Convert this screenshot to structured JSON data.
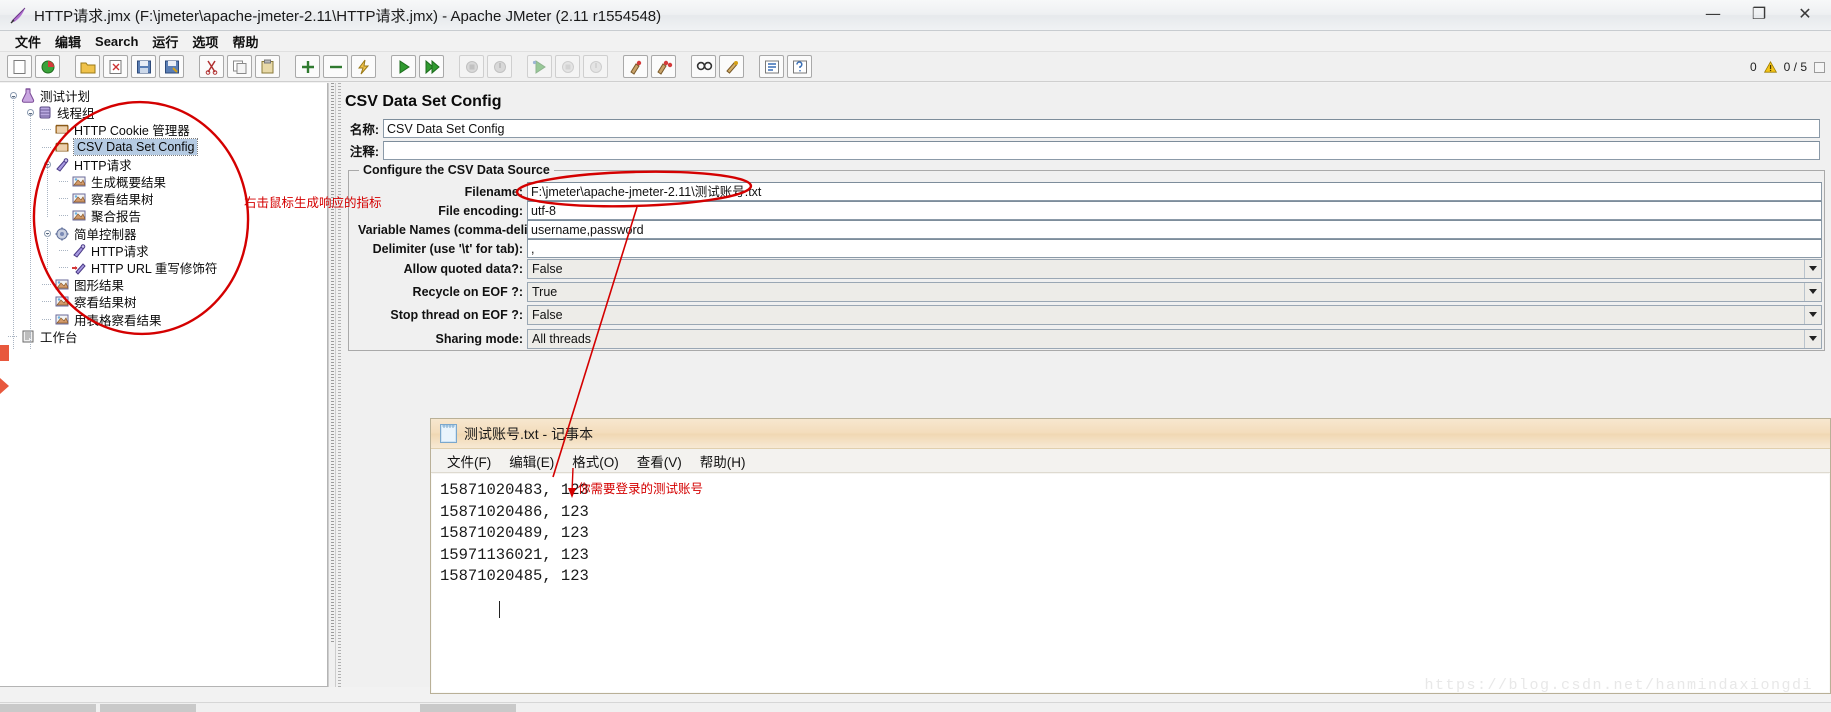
{
  "window": {
    "title": "HTTP请求.jmx (F:\\jmeter\\apache-jmeter-2.11\\HTTP请求.jmx) - Apache JMeter (2.11 r1554548)",
    "icon": "jmeter-feather-icon",
    "minimize_label": "—",
    "maximize_label": "❐",
    "close_label": "✕"
  },
  "menubar": {
    "items": [
      {
        "label": "文件",
        "name": "menu-file"
      },
      {
        "label": "编辑",
        "name": "menu-edit"
      },
      {
        "label": "Search",
        "name": "menu-search"
      },
      {
        "label": "运行",
        "name": "menu-run"
      },
      {
        "label": "选项",
        "name": "menu-options"
      },
      {
        "label": "帮助",
        "name": "menu-help"
      }
    ]
  },
  "toolbar": {
    "buttons": [
      {
        "name": "new-icon",
        "tip": "新建"
      },
      {
        "name": "templates-icon",
        "tip": "模板"
      },
      {
        "name": "open-icon",
        "tip": "打开"
      },
      {
        "name": "close-icon",
        "tip": "关闭"
      },
      {
        "name": "save-icon",
        "tip": "保存"
      },
      {
        "name": "save-as-icon",
        "tip": "另存为"
      },
      {
        "name": "cut-icon",
        "tip": "剪切"
      },
      {
        "name": "copy-icon",
        "tip": "复制"
      },
      {
        "name": "paste-icon",
        "tip": "粘贴"
      },
      {
        "name": "expand-icon",
        "tip": "展开全部"
      },
      {
        "name": "collapse-icon",
        "tip": "收起全部"
      },
      {
        "name": "toggle-icon",
        "tip": "启用/禁用"
      },
      {
        "name": "start-icon",
        "tip": "启动"
      },
      {
        "name": "start-no-pause-icon",
        "tip": "无间断启动"
      },
      {
        "name": "stop-icon",
        "tip": "停止"
      },
      {
        "name": "shutdown-icon",
        "tip": "关闭"
      },
      {
        "name": "remote-start-icon",
        "tip": "远程启动"
      },
      {
        "name": "remote-stop-icon",
        "tip": "远程停止"
      },
      {
        "name": "remote-shutdown-icon",
        "tip": "远程关闭"
      },
      {
        "name": "clear-icon",
        "tip": "清除"
      },
      {
        "name": "clear-all-icon",
        "tip": "清除全部"
      },
      {
        "name": "search-icon",
        "tip": "查找"
      },
      {
        "name": "search-reset-icon",
        "tip": "重置查找"
      },
      {
        "name": "function-helper-icon",
        "tip": "函数助手对话框"
      },
      {
        "name": "help-icon",
        "tip": "帮助"
      }
    ],
    "status": {
      "warning_count": "0",
      "warning_icon": "warning-triangle-icon",
      "thread_counter": "0 / 5"
    }
  },
  "tree": {
    "nodes": [
      {
        "label": "测试计划",
        "icon": "test-plan-icon",
        "depth": 0,
        "handle": true,
        "selected": false,
        "name": "tree-node-test-plan"
      },
      {
        "label": "线程组",
        "icon": "thread-group-icon",
        "depth": 1,
        "handle": true,
        "selected": false,
        "name": "tree-node-thread-group"
      },
      {
        "label": "HTTP Cookie 管理器",
        "icon": "cookie-manager-icon",
        "depth": 2,
        "handle": false,
        "selected": false,
        "name": "tree-node-http-cookie-manager"
      },
      {
        "label": "CSV Data Set Config",
        "icon": "config-element-icon",
        "depth": 2,
        "handle": false,
        "selected": true,
        "name": "tree-node-csv-data-set-config"
      },
      {
        "label": "HTTP请求",
        "icon": "http-sampler-icon",
        "depth": 2,
        "handle": true,
        "selected": false,
        "name": "tree-node-http-request-1"
      },
      {
        "label": "生成概要结果",
        "icon": "listener-icon",
        "depth": 3,
        "handle": false,
        "selected": false,
        "name": "tree-node-summariser"
      },
      {
        "label": "察看结果树",
        "icon": "listener-icon",
        "depth": 3,
        "handle": false,
        "selected": false,
        "name": "tree-node-view-results-tree-1"
      },
      {
        "label": "聚合报告",
        "icon": "listener-icon",
        "depth": 3,
        "handle": false,
        "selected": false,
        "name": "tree-node-aggregate-report"
      },
      {
        "label": "简单控制器",
        "icon": "simple-controller-icon",
        "depth": 2,
        "handle": true,
        "selected": false,
        "name": "tree-node-simple-controller"
      },
      {
        "label": "HTTP请求",
        "icon": "http-sampler-icon",
        "depth": 3,
        "handle": false,
        "selected": false,
        "name": "tree-node-http-request-2"
      },
      {
        "label": "HTTP URL 重写修饰符",
        "icon": "url-rewriting-icon",
        "depth": 3,
        "handle": false,
        "selected": false,
        "name": "tree-node-http-url-rewriting-modifier"
      },
      {
        "label": "图形结果",
        "icon": "listener-icon",
        "depth": 2,
        "handle": false,
        "selected": false,
        "name": "tree-node-graph-results"
      },
      {
        "label": "察看结果树",
        "icon": "listener-icon",
        "depth": 2,
        "handle": false,
        "selected": false,
        "name": "tree-node-view-results-tree-2"
      },
      {
        "label": "用表格察看结果",
        "icon": "listener-icon",
        "depth": 2,
        "handle": false,
        "selected": false,
        "name": "tree-node-view-results-in-table"
      },
      {
        "label": "工作台",
        "icon": "workbench-icon",
        "depth": 0,
        "handle": false,
        "selected": false,
        "name": "tree-node-workbench"
      }
    ]
  },
  "panel": {
    "title": "CSV Data Set Config",
    "name_label": "名称:",
    "name_value": "CSV Data Set Config",
    "comment_label": "注释:",
    "comment_value": "",
    "group_title": "Configure the CSV Data Source",
    "fields": [
      {
        "label": "Filename:",
        "value": "F:\\jmeter\\apache-jmeter-2.11\\测试账号.txt",
        "type": "text",
        "name": "filename-field"
      },
      {
        "label": "File encoding:",
        "value": "utf-8",
        "type": "text",
        "name": "file-encoding-field"
      },
      {
        "label": "Variable Names (comma-delimited):",
        "value": "username,password",
        "type": "text",
        "name": "variable-names-field"
      },
      {
        "label": "Delimiter (use '\\t' for tab):",
        "value": ",",
        "type": "text",
        "name": "delimiter-field"
      },
      {
        "label": "Allow quoted data?:",
        "value": "False",
        "type": "combo",
        "name": "allow-quoted-data-combo"
      },
      {
        "label": "Recycle on EOF ?:",
        "value": "True",
        "type": "combo",
        "name": "recycle-on-eof-combo"
      },
      {
        "label": "Stop thread on EOF ?:",
        "value": "False",
        "type": "combo",
        "name": "stop-thread-on-eof-combo"
      },
      {
        "label": "Sharing mode:",
        "value": "All threads",
        "type": "combo",
        "name": "sharing-mode-combo"
      }
    ]
  },
  "annotations": [
    {
      "text": "右击鼠标生成响应的指标",
      "name": "annotation-right-click-hint"
    },
    {
      "text": "你需要登录的测试账号",
      "name": "annotation-test-account-hint"
    }
  ],
  "notepad": {
    "title": "测试账号.txt - 记事本",
    "icon": "notepad-document-icon",
    "menu": [
      {
        "label": "文件(F)",
        "name": "notepad-menu-file"
      },
      {
        "label": "编辑(E)",
        "name": "notepad-menu-edit"
      },
      {
        "label": "格式(O)",
        "name": "notepad-menu-format"
      },
      {
        "label": "查看(V)",
        "name": "notepad-menu-view"
      },
      {
        "label": "帮助(H)",
        "name": "notepad-menu-help"
      }
    ],
    "lines": [
      "15871020483, 123",
      "15871020486, 123",
      "15871020489, 123",
      "15971136021, 123",
      "15871020485, 123"
    ]
  },
  "watermark": {
    "text": "https://blog.csdn.net/hanmindaxiongdi"
  },
  "colors": {
    "annotation_red": "#d40000",
    "selection_blue": "#b5cbe3",
    "titlebar": "#eef0f2",
    "notepad_title": "#f3dcbb"
  }
}
